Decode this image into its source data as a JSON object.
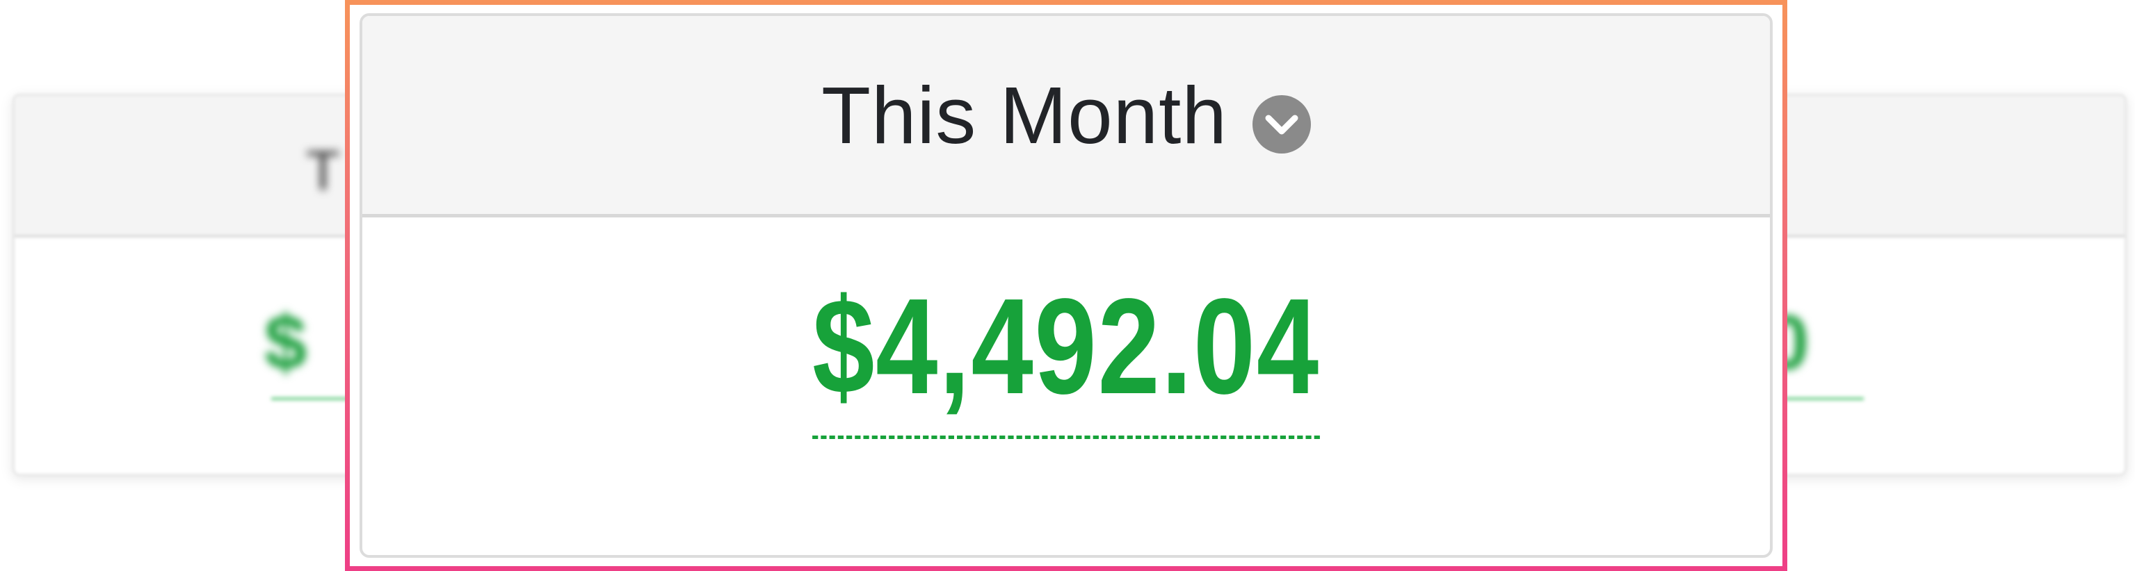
{
  "period_selector": {
    "label": "This Month",
    "icon": "chevron-down-icon"
  },
  "total": {
    "amount": "$4,492.04",
    "color": "#17a23a"
  },
  "background_cards": {
    "left_label_fragment": "T",
    "left_amount_fragment": "$",
    "right_amount_fragment": "0"
  },
  "colors": {
    "highlight_top": "#f7935a",
    "highlight_bottom": "#ee3f86",
    "header_bg": "#f5f5f5",
    "icon_bg": "#8a8a8a"
  }
}
